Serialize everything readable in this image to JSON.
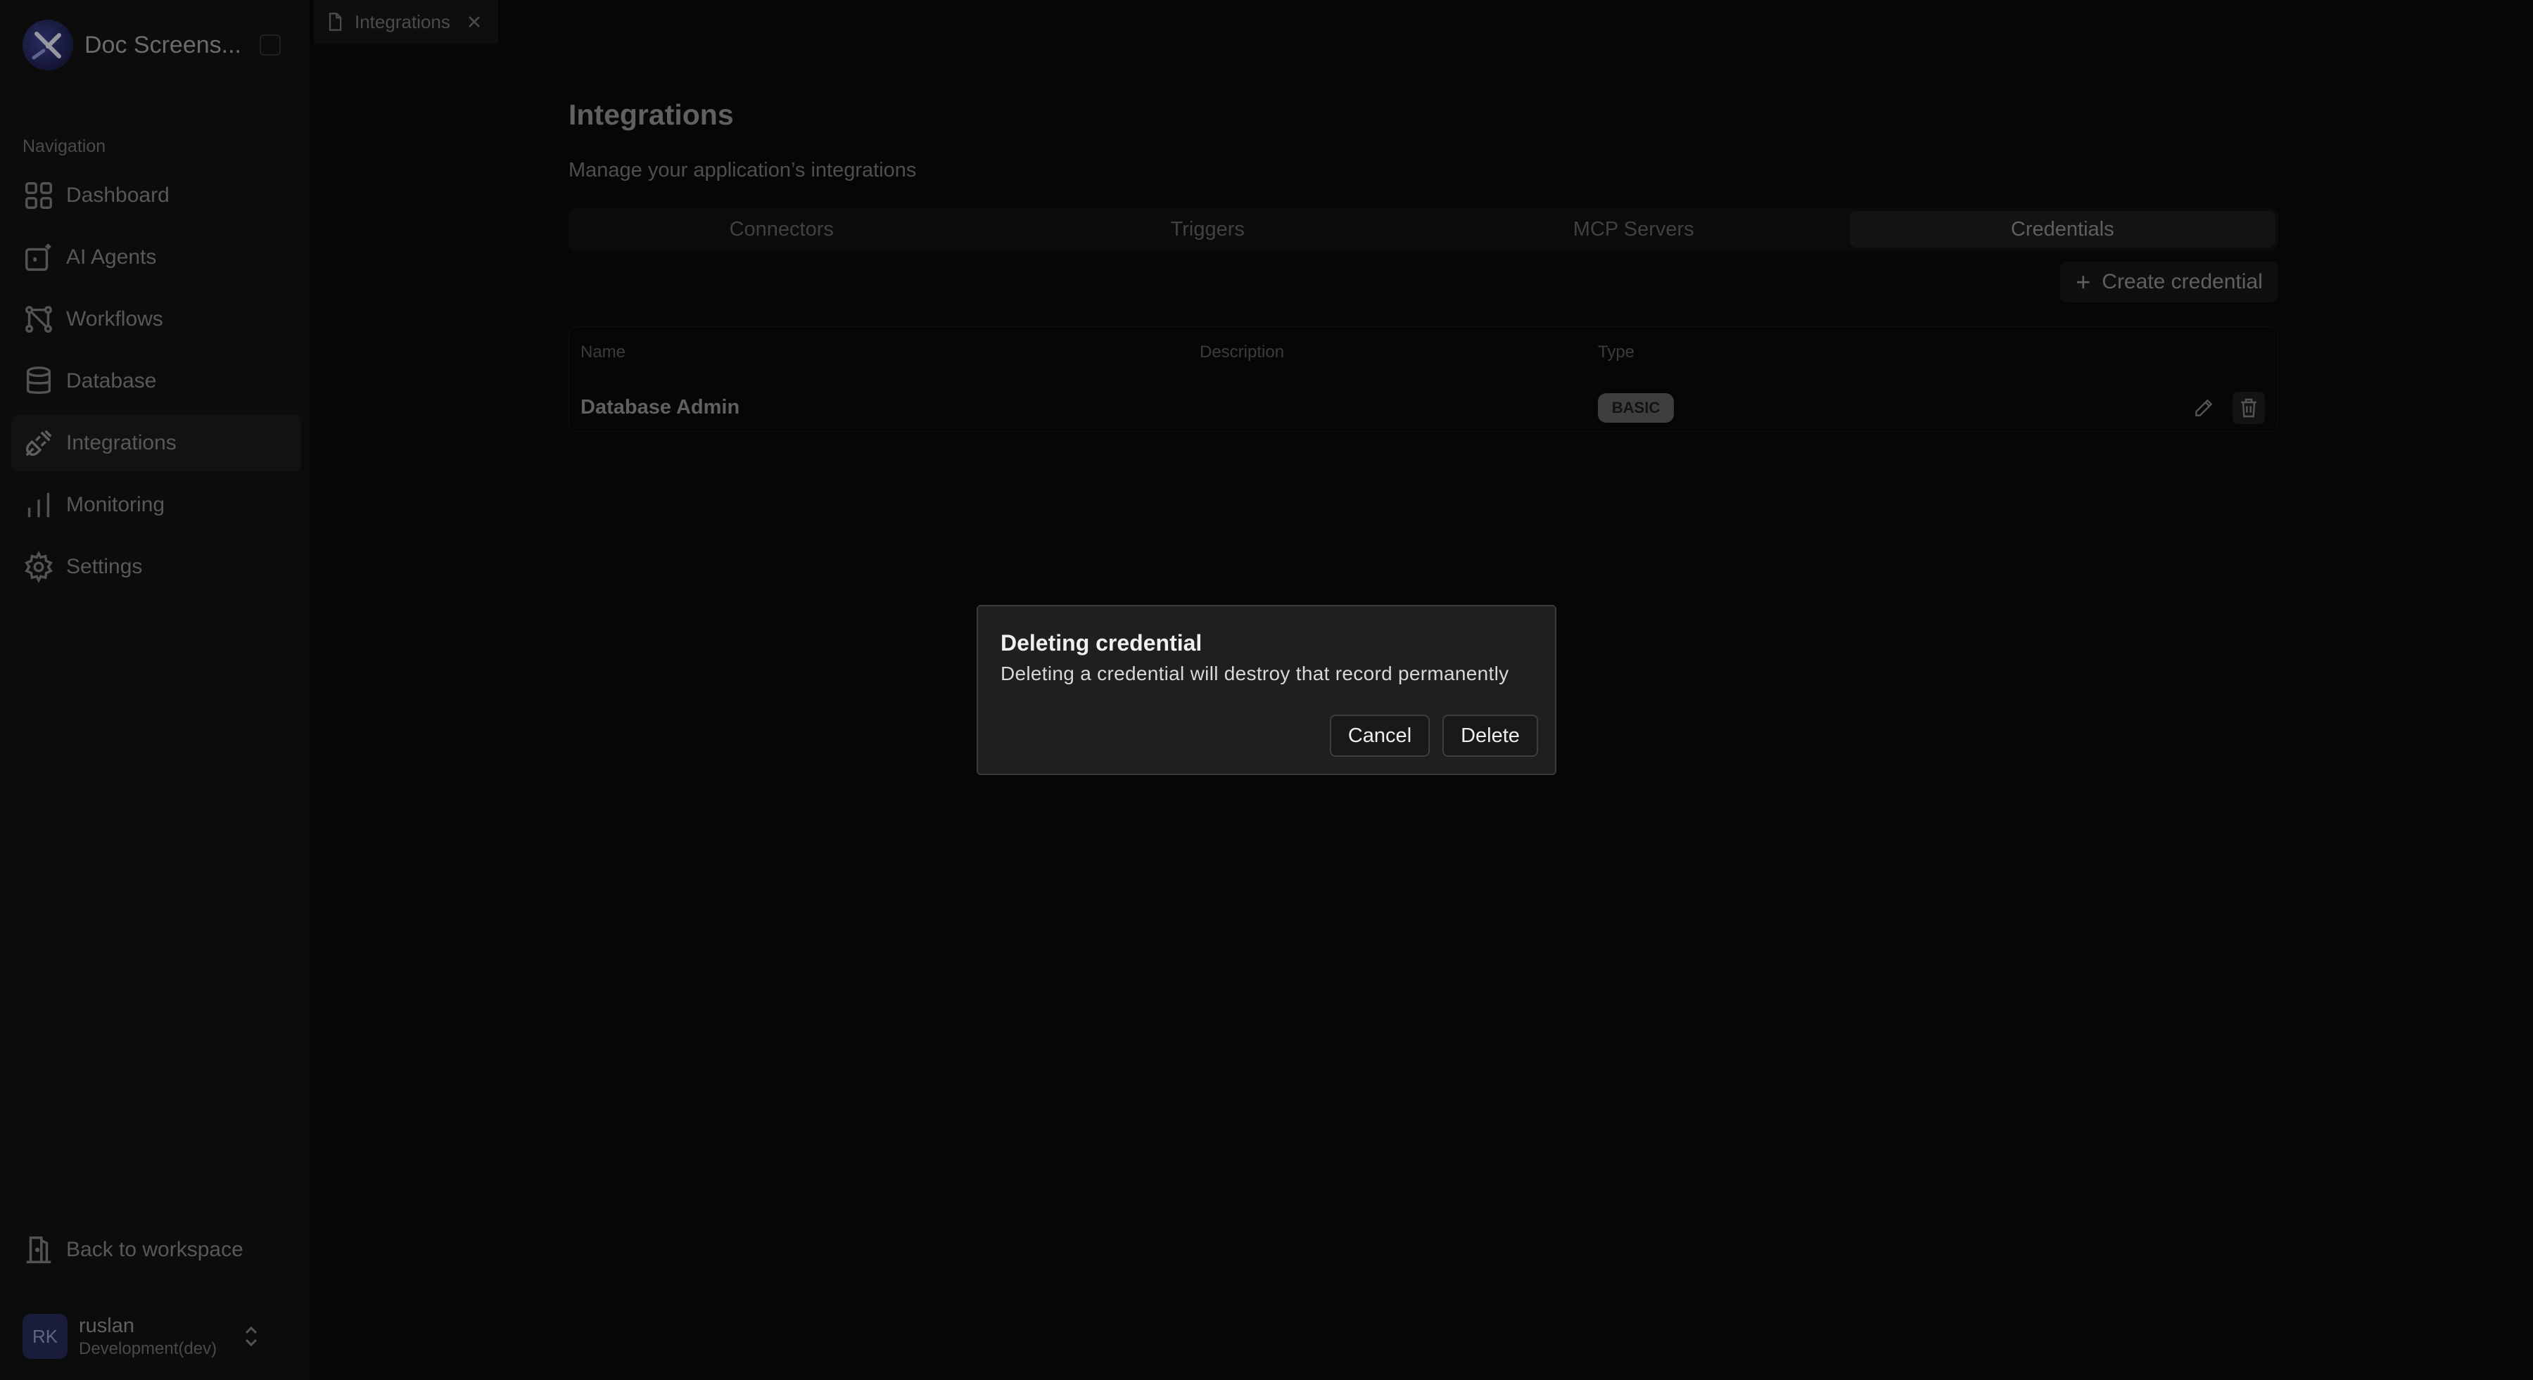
{
  "app": {
    "workspace_name": "Doc Screens..."
  },
  "sidebar": {
    "section_label": "Navigation",
    "items": [
      {
        "label": "Dashboard",
        "icon": "dashboard-icon"
      },
      {
        "label": "AI Agents",
        "icon": "ai-agents-icon"
      },
      {
        "label": "Workflows",
        "icon": "workflows-icon"
      },
      {
        "label": "Database",
        "icon": "database-icon"
      },
      {
        "label": "Integrations",
        "icon": "plug-icon",
        "active": true
      },
      {
        "label": "Monitoring",
        "icon": "bar-chart-icon"
      },
      {
        "label": "Settings",
        "icon": "gear-icon"
      }
    ],
    "back_label": "Back to workspace",
    "user": {
      "initials": "RK",
      "name": "ruslan",
      "environment": "Development(dev)"
    }
  },
  "top_tab": {
    "label": "Integrations"
  },
  "main": {
    "title": "Integrations",
    "subtitle": "Manage your application’s integrations",
    "tabs": [
      {
        "label": "Connectors"
      },
      {
        "label": "Triggers"
      },
      {
        "label": "MCP Servers"
      },
      {
        "label": "Credentials",
        "active": true
      }
    ],
    "create_button_label": "Create credential",
    "table": {
      "headers": [
        "Name",
        "Description",
        "Type"
      ],
      "rows": [
        {
          "name": "Database Admin",
          "description": "",
          "type": "BASIC"
        }
      ]
    }
  },
  "modal": {
    "title": "Deleting credential",
    "description": "Deleting a credential will destroy that record permanently",
    "cancel_label": "Cancel",
    "delete_label": "Delete"
  },
  "colors": {
    "background": "#0a0a0a",
    "sidebar": "#121212",
    "modal_background": "#1f1f1f",
    "modal_border": "#3a3a3a",
    "avatar": "#262a52",
    "badge": "#5a5a5a"
  }
}
